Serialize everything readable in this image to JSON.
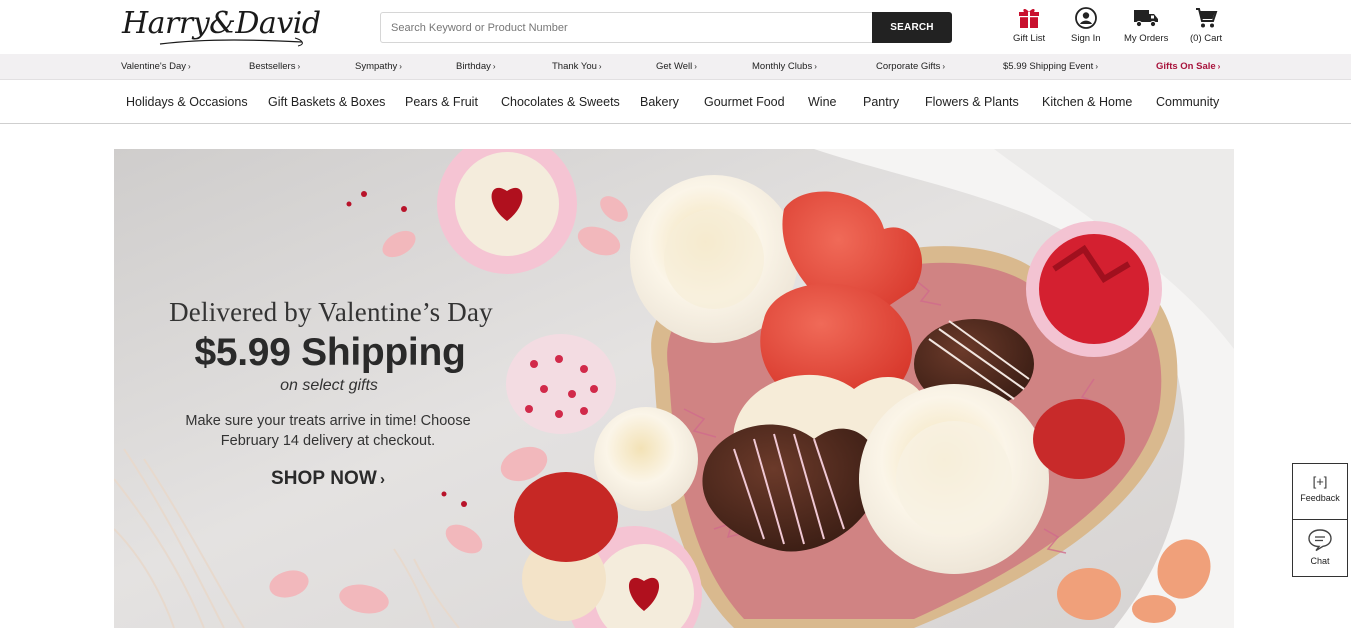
{
  "brand": {
    "logo_text": "Harry&David"
  },
  "search": {
    "placeholder": "Search Keyword or Product Number",
    "button_label": "SEARCH"
  },
  "utility": {
    "gift_list": "Gift List",
    "sign_in": "Sign In",
    "my_orders": "My Orders",
    "cart": "(0) Cart"
  },
  "promo_bar": {
    "items": [
      {
        "label": "Valentine's Day"
      },
      {
        "label": "Bestsellers"
      },
      {
        "label": "Sympathy"
      },
      {
        "label": "Birthday"
      },
      {
        "label": "Thank You"
      },
      {
        "label": "Get Well"
      },
      {
        "label": "Monthly Clubs"
      },
      {
        "label": "Corporate Gifts"
      },
      {
        "label": "$5.99 Shipping Event"
      },
      {
        "label": "Gifts On Sale"
      }
    ],
    "caret": "›"
  },
  "main_nav": {
    "items": [
      {
        "label": "Holidays & Occasions"
      },
      {
        "label": "Gift Baskets & Boxes"
      },
      {
        "label": "Pears & Fruit"
      },
      {
        "label": "Chocolates & Sweets"
      },
      {
        "label": "Bakery"
      },
      {
        "label": "Gourmet Food"
      },
      {
        "label": "Wine"
      },
      {
        "label": "Pantry"
      },
      {
        "label": "Flowers & Plants"
      },
      {
        "label": "Kitchen & Home"
      },
      {
        "label": "Community"
      }
    ]
  },
  "hero": {
    "eyebrow": "Delivered by Valentine’s Day",
    "headline": "$5.99 Shipping",
    "subhead": "on select gifts",
    "body_line1": "Make sure your treats arrive in time! Choose",
    "body_line2": "February 14 delivery at checkout.",
    "cta_label": "SHOP NOW",
    "cta_chevron": "›"
  },
  "widgets": {
    "feedback_icon": "[+]",
    "feedback_label": "Feedback",
    "chat_label": "Chat"
  },
  "colors": {
    "accent_dark": "#222222",
    "sale_red": "#a8133c",
    "promo_bar_bg": "#f2f0f2"
  }
}
